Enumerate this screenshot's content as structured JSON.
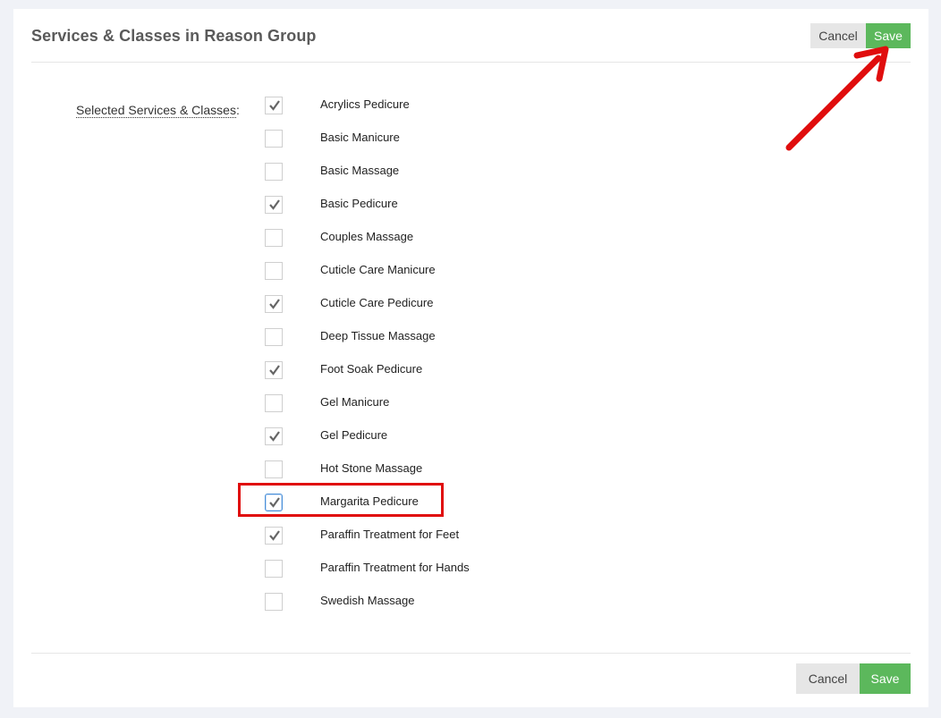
{
  "header": {
    "title": "Services & Classes in Reason Group",
    "cancel_label": "Cancel",
    "save_label": "Save"
  },
  "form": {
    "label": "Selected Services & Classes",
    "label_suffix": ":",
    "items": [
      {
        "label": "Acrylics Pedicure",
        "checked": true
      },
      {
        "label": "Basic Manicure",
        "checked": false
      },
      {
        "label": "Basic Massage",
        "checked": false
      },
      {
        "label": "Basic Pedicure",
        "checked": true
      },
      {
        "label": "Couples Massage",
        "checked": false
      },
      {
        "label": "Cuticle Care Manicure",
        "checked": false
      },
      {
        "label": "Cuticle Care Pedicure",
        "checked": true
      },
      {
        "label": "Deep Tissue Massage",
        "checked": false
      },
      {
        "label": "Foot Soak Pedicure",
        "checked": true
      },
      {
        "label": "Gel Manicure",
        "checked": false
      },
      {
        "label": "Gel Pedicure",
        "checked": true
      },
      {
        "label": "Hot Stone Massage",
        "checked": false
      },
      {
        "label": "Margarita Pedicure",
        "checked": true
      },
      {
        "label": "Paraffin Treatment for Feet",
        "checked": true
      },
      {
        "label": "Paraffin Treatment for Hands",
        "checked": false
      },
      {
        "label": "Swedish Massage",
        "checked": false
      }
    ]
  },
  "footer": {
    "cancel_label": "Cancel",
    "save_label": "Save"
  },
  "colors": {
    "save_green": "#5cb85c",
    "cancel_gray": "#e6e6e6",
    "annotation_red": "#e00d0d",
    "check_gray": "#666666"
  },
  "icons": {
    "check": "check-icon",
    "arrow": "arrow-annotation"
  }
}
